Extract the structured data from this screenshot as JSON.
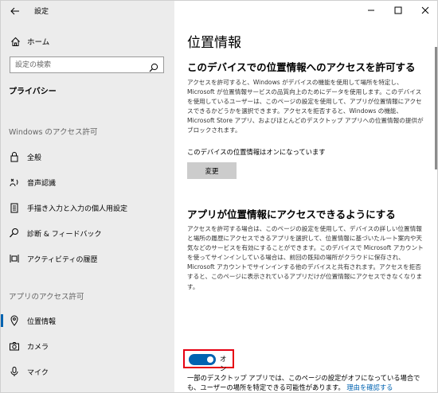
{
  "window": {
    "title": "設定",
    "controls": [
      "minimize",
      "maximize",
      "close"
    ]
  },
  "sidebar": {
    "home_label": "ホーム",
    "search_placeholder": "設定の検索",
    "category": "プライバシー",
    "section_windows": "Windows のアクセス許可",
    "windows_items": [
      {
        "label": "全般",
        "icon": "lock-icon"
      },
      {
        "label": "音声認識",
        "icon": "speech-icon"
      },
      {
        "label": "手描き入力と入力の個人用設定",
        "icon": "clipboard-icon"
      },
      {
        "label": "診断 & フィードバック",
        "icon": "diagnostics-icon"
      },
      {
        "label": "アクティビティの履歴",
        "icon": "activity-icon"
      }
    ],
    "section_apps": "アプリのアクセス許可",
    "app_items": [
      {
        "label": "位置情報",
        "icon": "location-icon",
        "selected": true
      },
      {
        "label": "カメラ",
        "icon": "camera-icon"
      },
      {
        "label": "マイク",
        "icon": "microphone-icon"
      }
    ]
  },
  "main": {
    "title": "位置情報",
    "section1": {
      "heading": "このデバイスでの位置情報へのアクセスを許可する",
      "body": "アクセスを許可すると、Windows がデバイスの機能を使用して場所を特定し、Microsoft が位置情報サービスの品質向上のためにデータを使用します。このデバイスを使用しているユーザーは、このページの設定を使用して、アプリが位置情報にアクセスできるかどうかを選択できます。アクセスを拒否すると、Windows の機能、Microsoft Store アプリ、およびほとんどのデスクトップ アプリへの位置情報の提供がブロックされます。",
      "status": "このデバイスの位置情報はオンになっています",
      "button": "変更"
    },
    "section2": {
      "heading": "アプリが位置情報にアクセスできるようにする",
      "body": "アクセスを許可する場合は、このページの設定を使用して、デバイスの詳しい位置情報と場所の履歴にアクセスできるアプリを選択して、位置情報に基づいたルート案内や天気などのサービスを有効にすることができます。このデバイスで Microsoft アカウントを使ってサインインしている場合は、前回の既知の場所がクラウドに保存され、Microsoft アカウントでサインインする他のデバイスと共有されます。アクセスを拒否すると、このページに表示されているアプリだけが位置情報にアクセスできなくなります。",
      "toggle_state": true,
      "toggle_label": "オン",
      "footnote": "一部のデスクトップ アプリでは、このページの設定がオフになっている場合でも、ユーザーの場所を特定できる可能性があります。",
      "footnote_link": "理由を確認する"
    }
  }
}
